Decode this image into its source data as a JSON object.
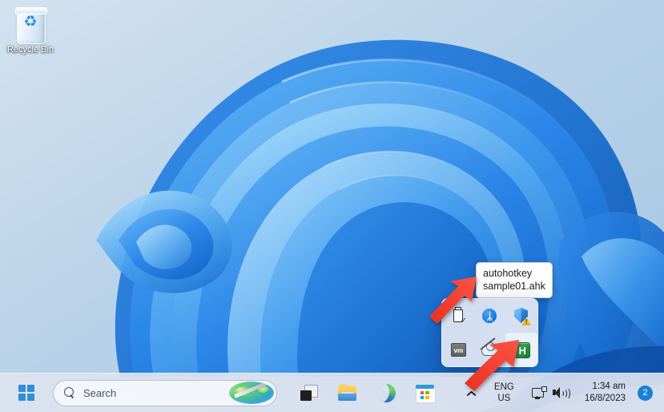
{
  "desktop": {
    "icons": [
      {
        "label": "Recycle Bin",
        "icon": "recycle-bin-icon"
      }
    ]
  },
  "tooltip": {
    "line1": "autohotkey",
    "line2": "sample01.ahk"
  },
  "tray_popup": {
    "items": [
      {
        "name": "safely-remove-hardware-icon",
        "title": "Safely Remove Hardware and Eject Media",
        "hover": false
      },
      {
        "name": "bluetooth-icon",
        "title": "Bluetooth Devices",
        "glyph": "ᛦ",
        "hover": false
      },
      {
        "name": "windows-security-icon",
        "title": "Windows Security - actions recommended",
        "badge": "!",
        "hover": false
      },
      {
        "name": "vmware-tray-icon",
        "title": "VMware",
        "glyph": "vm",
        "hover": false
      },
      {
        "name": "onedrive-offline-icon",
        "title": "OneDrive - not signed in",
        "hover": false
      },
      {
        "name": "autohotkey-tray-icon",
        "title": "autohotkey sample01.ahk",
        "glyph": "H",
        "hover": true
      }
    ]
  },
  "taskbar": {
    "start_label": "Start",
    "search": {
      "placeholder": "Search",
      "value": "Search"
    },
    "apps": [
      {
        "name": "task-view-button",
        "label": "Task View"
      },
      {
        "name": "file-explorer-button",
        "label": "File Explorer"
      },
      {
        "name": "microsoft-edge-button",
        "label": "Microsoft Edge"
      },
      {
        "name": "microsoft-store-button",
        "label": "Microsoft Store"
      }
    ],
    "tray": {
      "overflow_label": "Show hidden icons",
      "language": {
        "line1": "ENG",
        "line2": "US"
      },
      "network_label": "Network",
      "volume_label": "Volume",
      "clock": {
        "time": "1:34 am",
        "date": "16/8/2023"
      },
      "notifications_count": "2"
    }
  },
  "annotations": {
    "arrow_color": "#f03b2d",
    "arrows": [
      {
        "name": "arrow-to-tooltip",
        "points_to": "tooltip"
      },
      {
        "name": "arrow-to-autohotkey-icon",
        "points_to": "autohotkey-tray-icon"
      }
    ]
  },
  "colors": {
    "accent": "#2f8fd8",
    "taskbar": "#dfe4f0",
    "popup": "#e2e7f3",
    "arrow_red": "#f03b2d",
    "ahk_green": "#2f9445"
  }
}
